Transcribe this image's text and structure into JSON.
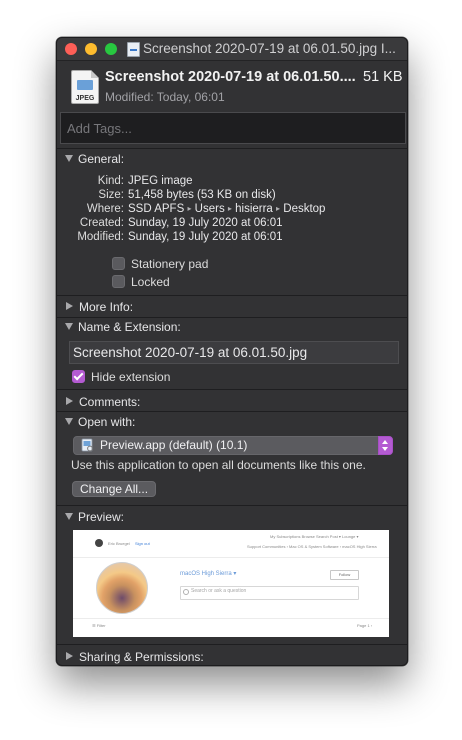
{
  "window": {
    "title": "Screenshot 2020-07-19 at 06.01.50.jpg I...",
    "traffic_lights": [
      "close",
      "minimize",
      "zoom"
    ]
  },
  "header": {
    "icon_label": "JPEG",
    "name": "Screenshot 2020-07-19 at 06.01.50....",
    "size": "51 KB",
    "modified": "Modified: Today, 06:01"
  },
  "tags": {
    "placeholder": "Add Tags..."
  },
  "sections": {
    "general": "General:",
    "more_info": "More Info:",
    "name_extension": "Name & Extension:",
    "comments": "Comments:",
    "open_with": "Open with:",
    "preview": "Preview:",
    "sharing": "Sharing & Permissions:"
  },
  "general": {
    "kind_key": "Kind:",
    "kind_val": "JPEG image",
    "size_key": "Size:",
    "size_val": "51,458 bytes (53 KB on disk)",
    "where_key": "Where:",
    "where_path": [
      "SSD APFS",
      "Users",
      "hisierra",
      "Desktop"
    ],
    "path_separator": "▸",
    "created_key": "Created:",
    "created_val": "Sunday, 19 July 2020 at 06:01",
    "modified_key": "Modified:",
    "modified_val": "Sunday, 19 July 2020 at 06:01",
    "stationery_label": "Stationery pad",
    "stationery_checked": false,
    "locked_label": "Locked",
    "locked_checked": false
  },
  "name_extension": {
    "value": "Screenshot 2020-07-19 at 06.01.50.jpg",
    "hide_extension_label": "Hide extension",
    "hide_extension_checked": true
  },
  "open_with": {
    "app": "Preview.app (default) (10.1)",
    "hint": "Use this application to open all documents like this one.",
    "change_all": "Change All..."
  },
  "preview_content": {
    "user": "Eric Bruegel",
    "sign_out": "Sign out",
    "nav": "My Subscriptions   Browse   Search   Post ▾   Lounge ▾",
    "breadcrumb": "Support Communities  ›  Mac OS & System Software  ›  macOS High Sierra",
    "title": "macOS High Sierra ▾",
    "follow": "Follow",
    "search_placeholder": "Search or ask a question",
    "filter": "☰ Filter",
    "page": "Page 1  ›"
  },
  "colors": {
    "window_bg": "#323234",
    "accent": "#b45bd2",
    "text": "#dcdcdc"
  }
}
